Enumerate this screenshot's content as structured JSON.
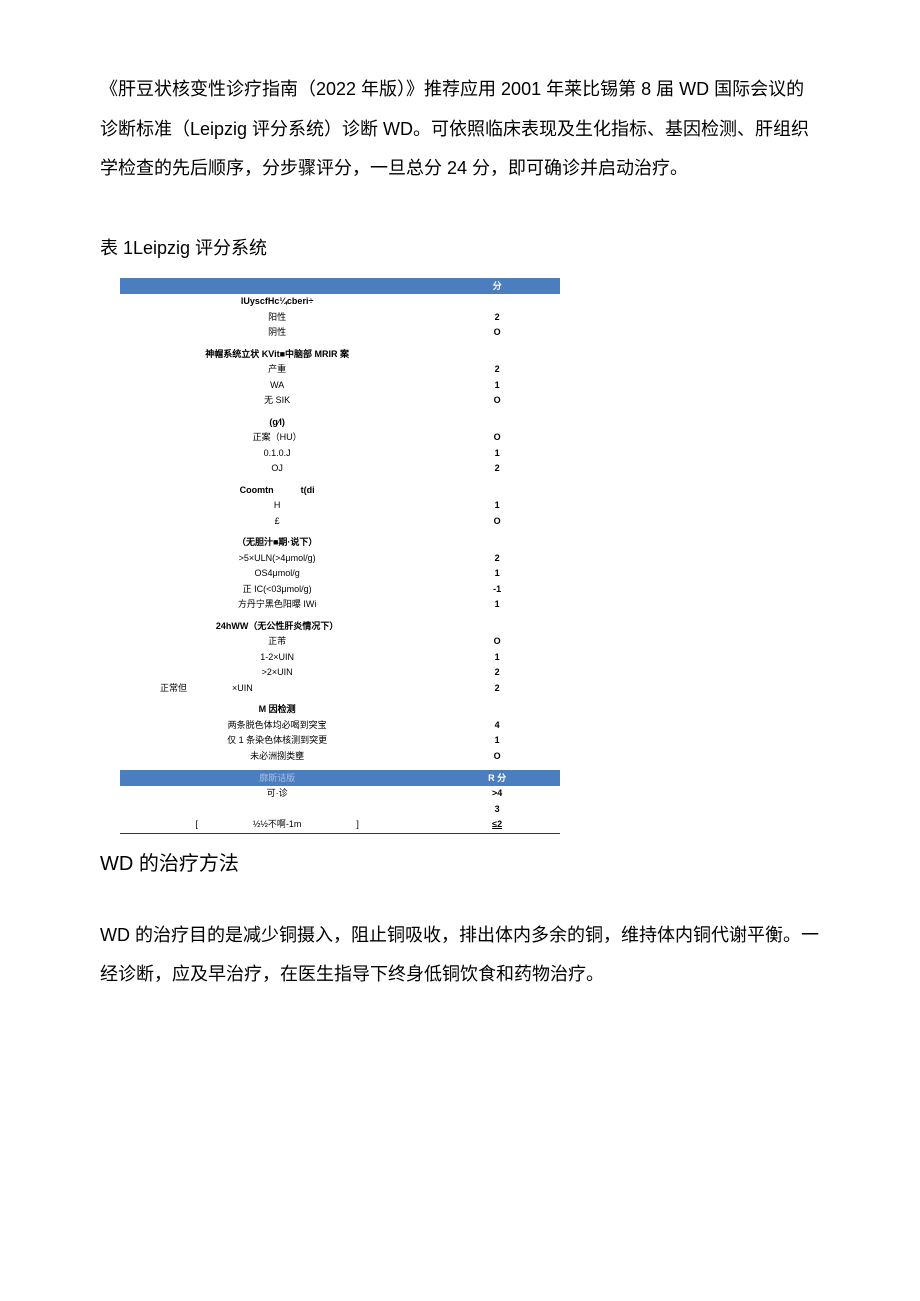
{
  "intro": "《肝豆状核变性诊疗指南（2022 年版）》推荐应用 2001 年莱比锡第 8 届 WD 国际会议的诊断标准（Leipzig 评分系统）诊断 WD。可依照临床表现及生化指标、基因检测、肝组织学检查的先后顺序，分步骤评分，一旦总分 24 分，即可确诊并启动治疗。",
  "table_title": "表 1Leipzig 评分系统",
  "score_header": "分",
  "groups": [
    {
      "header": "lUyscfHc¼cberi÷",
      "rows": [
        {
          "label": "阳性",
          "score": "2"
        },
        {
          "label": "阴性",
          "score": "O"
        }
      ]
    },
    {
      "header": "神帽系统立状 KVit■中脑部 MRIR 案",
      "rows": [
        {
          "label": "产重",
          "score": "2"
        },
        {
          "label": "WA",
          "score": "1"
        },
        {
          "label": "无 SIK",
          "score": "O"
        }
      ]
    },
    {
      "header": "(g⁄l)",
      "rows": [
        {
          "label": "正案（HU）",
          "score": "O"
        },
        {
          "label": "0.1.0.J",
          "score": "1"
        },
        {
          "label": "OJ",
          "score": "2"
        }
      ]
    },
    {
      "header": "Coomtn   t(di",
      "rows": [
        {
          "label": "H",
          "score": "1"
        },
        {
          "label": "£",
          "score": "O"
        }
      ]
    },
    {
      "header": "（无胆汁■期·说下）",
      "rows": [
        {
          "label": ">5×ULN(>4μmol/g)",
          "score": "2"
        },
        {
          "label": "OS4μmol/g",
          "score": "1"
        },
        {
          "label": "正 IC(<03μmol/g)",
          "score": "-1"
        },
        {
          "label": "方丹宁黑色阳曝 IWi",
          "score": "1"
        }
      ]
    },
    {
      "header": "24hWW（无公性肝炎情况下）",
      "rows": [
        {
          "label": "正芾",
          "score": "O"
        },
        {
          "label": "1-2×UIN",
          "score": "1"
        },
        {
          "label": ">2×UIN",
          "score": "2"
        },
        {
          "label": "正常但     ×UIN",
          "score": "2",
          "align": "indent-left"
        }
      ]
    },
    {
      "header": "M 因检测",
      "rows": [
        {
          "label": "两条脱色体均必喝到突宝",
          "score": "4"
        },
        {
          "label": "仅 1 条染色体核测到突更",
          "score": "1"
        },
        {
          "label": "未必洲捌类壅",
          "score": "O"
        }
      ]
    }
  ],
  "diagnosis_header_label": "廓斯诘版",
  "diagnosis_header_score": "R 分",
  "diagnosis_rows": [
    {
      "label": "可·诊",
      "score": ">4"
    },
    {
      "label": "",
      "score": "3"
    },
    {
      "label": "½½不啊-1m",
      "score": "≤2",
      "bracket": true,
      "underline": true
    }
  ],
  "section_title": "WD 的治疗方法",
  "closing": "WD 的治疗目的是减少铜摄入，阻止铜吸收，排出体内多余的铜，维持体内铜代谢平衡。一经诊断，应及早治疗，在医生指导下终身低铜饮食和药物治疗。"
}
